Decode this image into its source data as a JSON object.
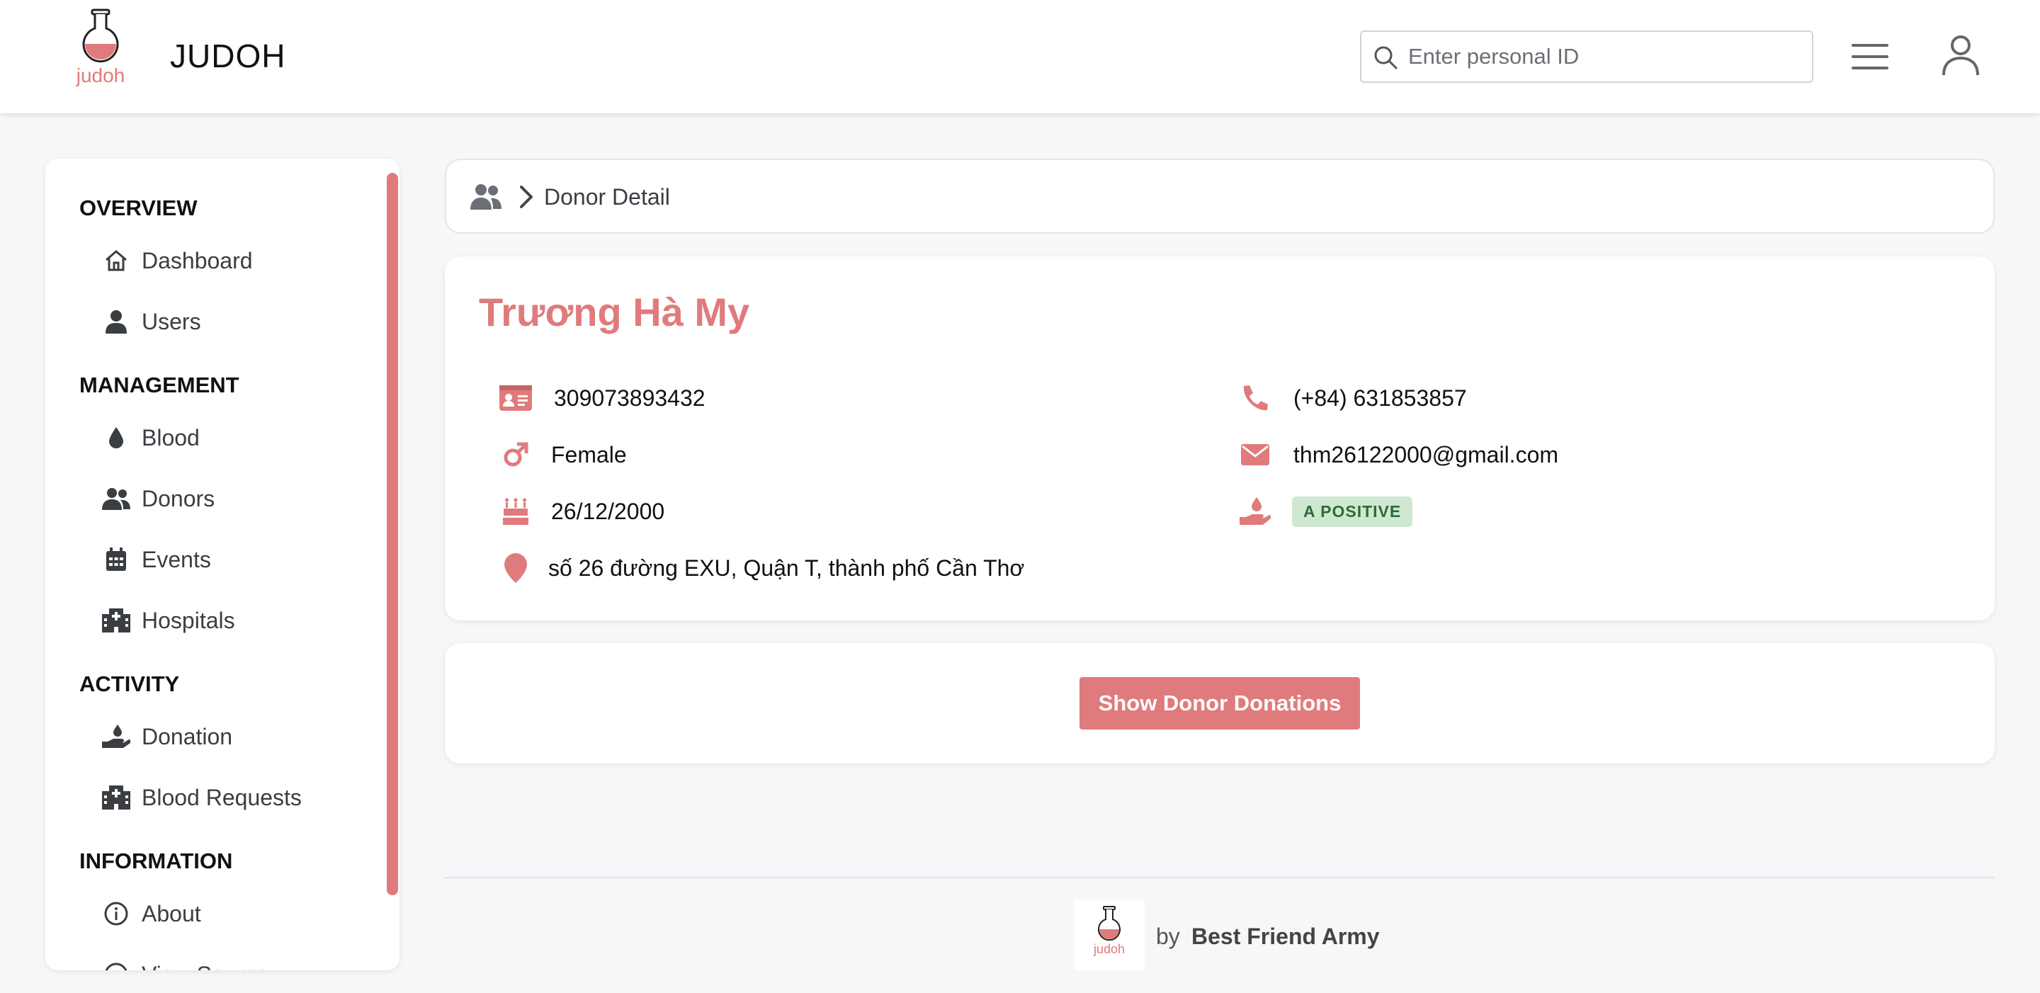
{
  "header": {
    "logo_text": "judoh",
    "title": "JUDOH",
    "search_placeholder": "Enter personal ID"
  },
  "sidebar": {
    "sections": [
      {
        "title": "OVERVIEW",
        "items": [
          {
            "label": "Dashboard",
            "icon": "home-icon"
          },
          {
            "label": "Users",
            "icon": "user-icon"
          }
        ]
      },
      {
        "title": "MANAGEMENT",
        "items": [
          {
            "label": "Blood",
            "icon": "droplet-icon"
          },
          {
            "label": "Donors",
            "icon": "users-icon"
          },
          {
            "label": "Events",
            "icon": "calendar-icon"
          },
          {
            "label": "Hospitals",
            "icon": "hospital-icon"
          }
        ]
      },
      {
        "title": "ACTIVITY",
        "items": [
          {
            "label": "Donation",
            "icon": "hand-holding-droplet-icon"
          },
          {
            "label": "Blood Requests",
            "icon": "hospital-icon"
          }
        ]
      },
      {
        "title": "INFORMATION",
        "items": [
          {
            "label": "About",
            "icon": "info-icon"
          },
          {
            "label": "View Source",
            "icon": "code-icon"
          }
        ]
      }
    ]
  },
  "breadcrumb": {
    "current": "Donor Detail"
  },
  "donor": {
    "name": "Trương Hà My",
    "personal_id": "309073893432",
    "gender": "Female",
    "birthday": "26/12/2000",
    "address": "số 26 đường EXU, Quận T, thành phố Cần Thơ",
    "phone": "(+84) 631853857",
    "email": "thm26122000@gmail.com",
    "blood_type": "A POSITIVE"
  },
  "actions": {
    "show_donations": "Show Donor Donations"
  },
  "footer": {
    "logo_text": "judoh",
    "by": "by",
    "team": "Best Friend Army"
  },
  "colors": {
    "accent": "#e07b7d",
    "badge_bg": "#cfe8d2",
    "badge_text": "#2e6b35"
  }
}
